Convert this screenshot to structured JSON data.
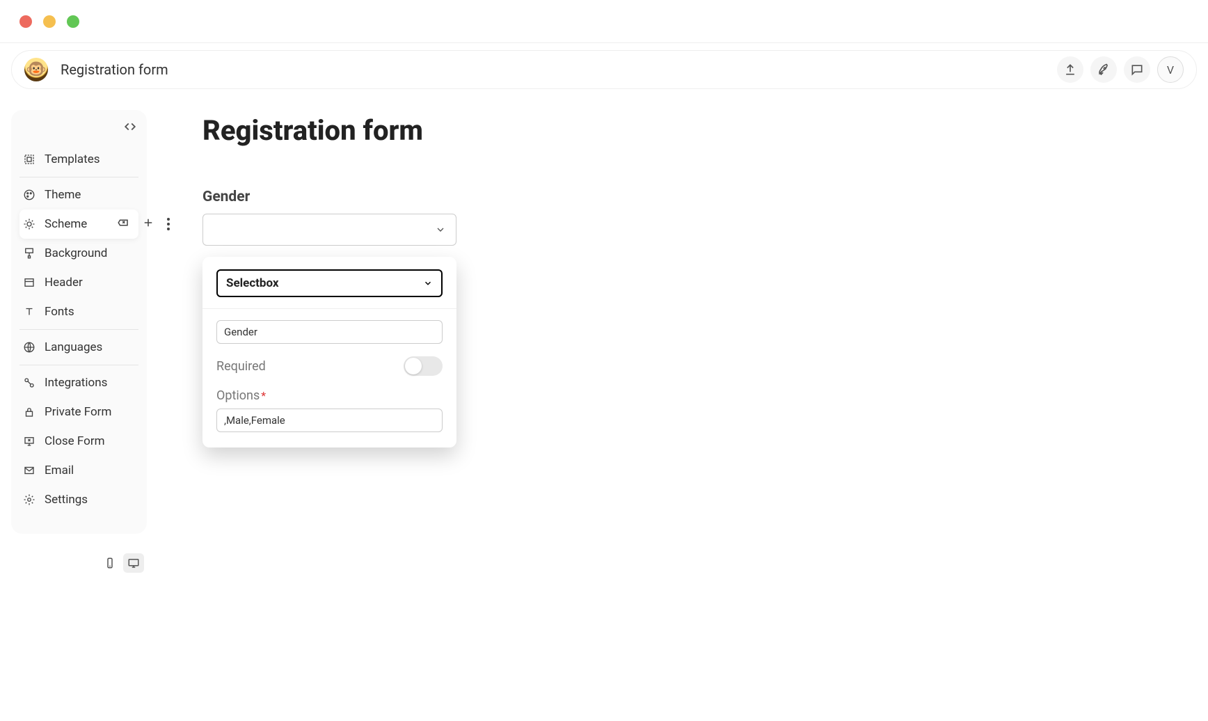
{
  "header": {
    "title": "Registration form",
    "avatar_initial": "V"
  },
  "sidebar": {
    "items": [
      {
        "label": "Templates"
      },
      {
        "label": "Theme"
      },
      {
        "label": "Scheme"
      },
      {
        "label": "Background"
      },
      {
        "label": "Header"
      },
      {
        "label": "Fonts"
      },
      {
        "label": "Languages"
      },
      {
        "label": "Integrations"
      },
      {
        "label": "Private Form"
      },
      {
        "label": "Close Form"
      },
      {
        "label": "Email"
      },
      {
        "label": "Settings"
      }
    ]
  },
  "form": {
    "title": "Registration form",
    "field_label": "Gender"
  },
  "config": {
    "type_value": "Selectbox",
    "name_value": "Gender",
    "required_label": "Required",
    "options_label": "Options",
    "options_value": ",Male,Female"
  }
}
